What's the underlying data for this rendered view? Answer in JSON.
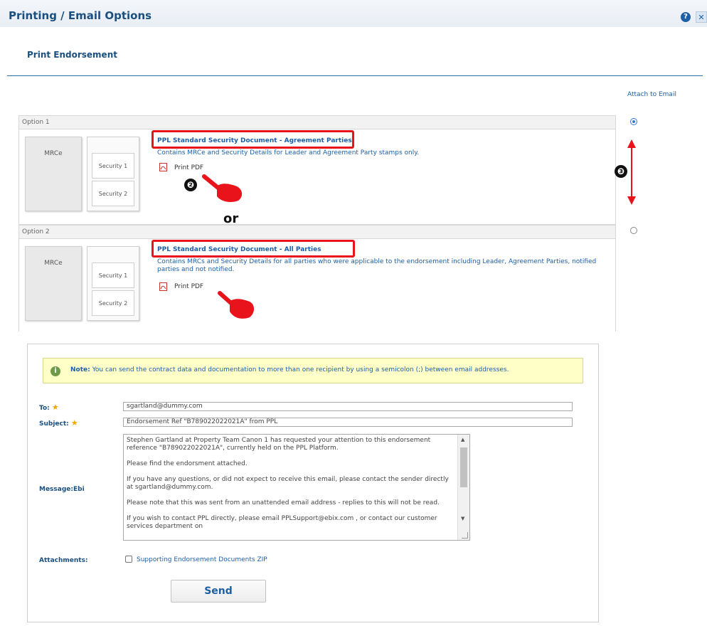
{
  "dialog": {
    "title": "Printing / Email Options",
    "help_icon": "question-circle-icon",
    "close_icon": "close-icon"
  },
  "section": {
    "title": "Print Endorsement",
    "attach_label": "Attach to Email"
  },
  "options": [
    {
      "header": "Option 1",
      "mrce_label": "MRCe",
      "security_1": "Security 1",
      "security_2": "Security 2",
      "link": "PPL Standard Security Document - Agreement Parties",
      "description": "Contains MRCe and Security Details for Leader and Agreement Party stamps only.",
      "print_label": "Print PDF",
      "selected": true
    },
    {
      "header": "Option 2",
      "mrce_label": "MRCe",
      "security_1": "Security 1",
      "security_2": "Security 2",
      "link": "PPL Standard Security Document - All Parties",
      "description": "Contains MRCs and Security Details for all parties who were applicable to the endorsement including Leader, Agreement Parties, notified parties and not notified.",
      "print_label": "Print PDF",
      "selected": false
    }
  ],
  "annotations": {
    "step_2": "❷",
    "step_3": "❸",
    "or_label": "or",
    "pointer_icon": "pointing-hand-icon"
  },
  "note": {
    "bold": "Note:",
    "text": " You can send the contract data and documentation to more than one recipient by using a semicolon (;) between email addresses."
  },
  "email": {
    "to_label": "To:",
    "to_value": "sgartland@dummy.com",
    "subject_label": "Subject:",
    "subject_value": "Endorsement Ref \"B789022022021A\" from PPL",
    "message_label": "Message:Ebi",
    "message_value": "Stephen Gartland at Property Team Canon 1 has requested your attention to this endorsement reference \"B789022022021A\", currently held on the PPL Platform.\n\nPlease find the endorsment attached.\n\nIf you have any questions, or did not expect to receive this email, please contact the sender directly at sgartland@dummy.com.\n\nPlease note that this was sent from an unattended email address - replies to this will not be read.\n\nIf you wish to contact PPL directly, please email PPLSupport@ebix.com , or contact our customer services department on",
    "attachments_label": "Attachments:",
    "attachment_option": "Supporting Endorsement Documents ZIP",
    "send_label": "Send"
  },
  "colors": {
    "accent": "#1d5fa6",
    "highlight": "#e8131b",
    "note_bg": "#ffffc8"
  }
}
